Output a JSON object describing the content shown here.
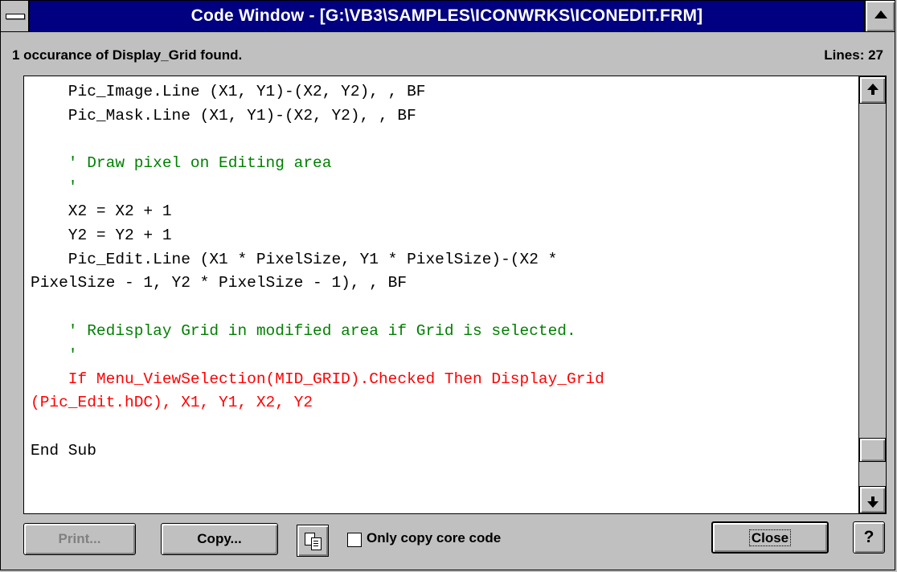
{
  "window": {
    "title": "Code Window - [G:\\VB3\\SAMPLES\\ICONWRKS\\ICONEDIT.FRM]"
  },
  "status": {
    "found_text": "1 occurance of Display_Grid found.",
    "lines_label": "Lines: 27"
  },
  "code": {
    "lines": [
      {
        "text": "    Pic_Image.Line (X1, Y1)-(X2, Y2), , BF",
        "kind": "code"
      },
      {
        "text": "    Pic_Mask.Line (X1, Y1)-(X2, Y2), , BF",
        "kind": "code"
      },
      {
        "text": "",
        "kind": "code"
      },
      {
        "text": "    ' Draw pixel on Editing area",
        "kind": "comment"
      },
      {
        "text": "    '",
        "kind": "comment"
      },
      {
        "text": "    X2 = X2 + 1",
        "kind": "code"
      },
      {
        "text": "    Y2 = Y2 + 1",
        "kind": "code"
      },
      {
        "text": "    Pic_Edit.Line (X1 * PixelSize, Y1 * PixelSize)-(X2 *",
        "kind": "code"
      },
      {
        "text": "PixelSize - 1, Y2 * PixelSize - 1), , BF",
        "kind": "code"
      },
      {
        "text": "",
        "kind": "code"
      },
      {
        "text": "    ' Redisplay Grid in modified area if Grid is selected.",
        "kind": "comment"
      },
      {
        "text": "    '",
        "kind": "comment"
      },
      {
        "text": "    If Menu_ViewSelection(MID_GRID).Checked Then Display_Grid",
        "kind": "highlight"
      },
      {
        "text": "(Pic_Edit.hDC), X1, Y1, X2, Y2",
        "kind": "highlight"
      },
      {
        "text": "",
        "kind": "code"
      },
      {
        "text": "End Sub",
        "kind": "code"
      }
    ],
    "colors": {
      "code": "#000000",
      "comment": "#008000",
      "highlight": "#ff0000"
    }
  },
  "buttons": {
    "print": "Print...",
    "copy": "Copy...",
    "copy_icon": "copy-pages-icon",
    "only_copy_label": "Only copy core code",
    "only_copy_checked": false,
    "close": "Close",
    "help": "?"
  },
  "icons": {
    "system_menu": "system-menu-icon",
    "title_button": "maximize-triangle-icon",
    "scroll_up": "scroll-up-arrow-icon",
    "scroll_down": "scroll-down-arrow-icon"
  }
}
